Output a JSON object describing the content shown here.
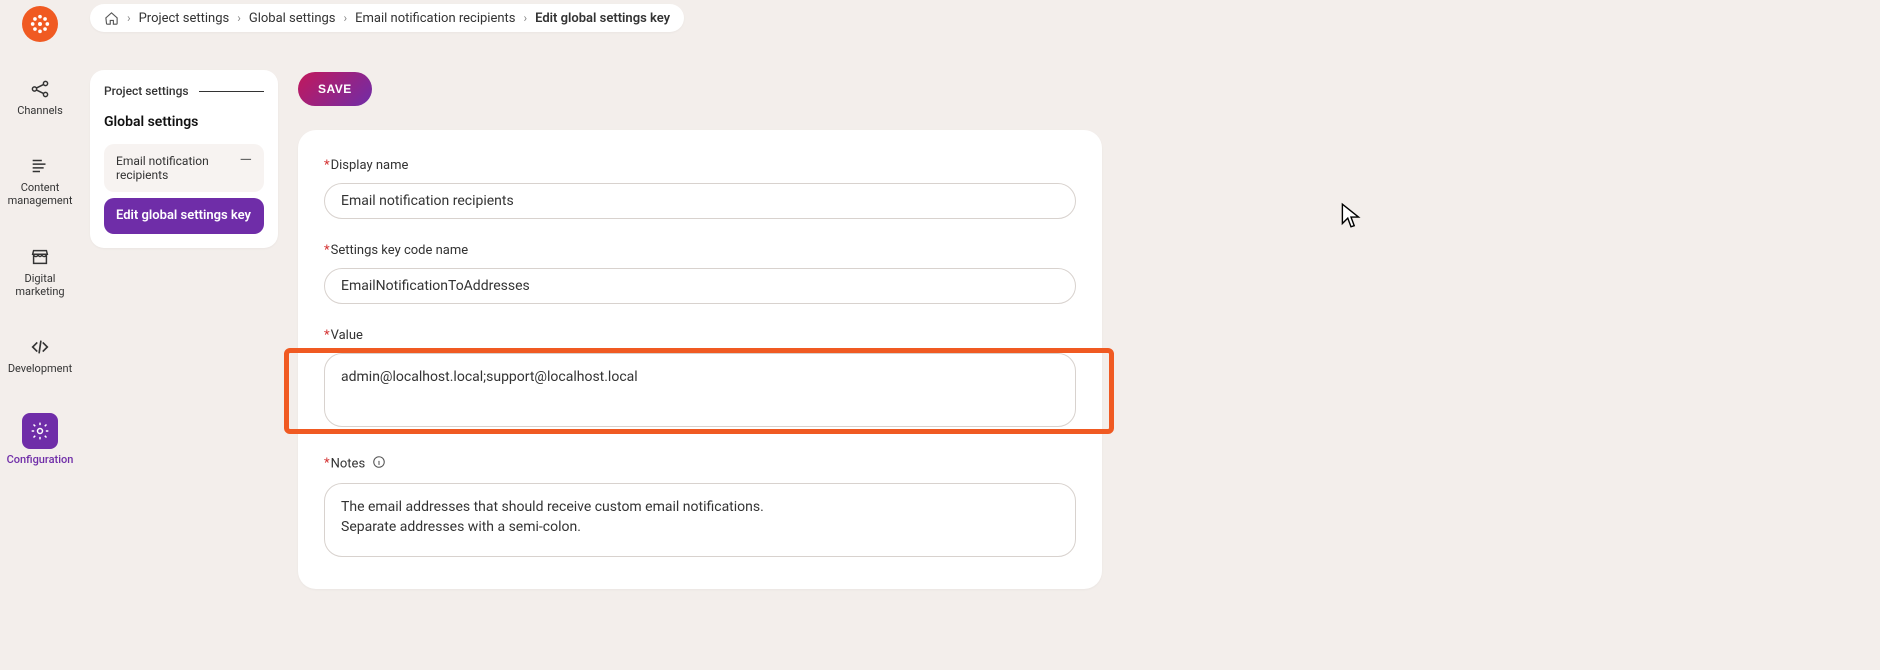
{
  "logo": {
    "icon": "snowflake-icon"
  },
  "vnav": [
    {
      "id": "channels",
      "label": "Channels",
      "icon": "share-icon",
      "active": false
    },
    {
      "id": "content-management",
      "label": "Content\nmanagement",
      "icon": "lines-icon",
      "active": false
    },
    {
      "id": "digital-marketing",
      "label": "Digital\nmarketing",
      "icon": "store-icon",
      "active": false
    },
    {
      "id": "development",
      "label": "Development",
      "icon": "code-icon",
      "active": false
    },
    {
      "id": "configuration",
      "label": "Configuration",
      "icon": "gear-icon",
      "active": true
    }
  ],
  "breadcrumb": {
    "items": [
      {
        "kind": "home"
      },
      {
        "label": "Project settings"
      },
      {
        "label": "Global settings"
      },
      {
        "label": "Email notification recipients"
      },
      {
        "label": "Edit global settings key",
        "last": true
      }
    ]
  },
  "sidebar": {
    "top_label": "Project settings",
    "heading": "Global settings",
    "sub_item": "Email notification recipients",
    "active_item": "Edit global settings key"
  },
  "save_label": "SAVE",
  "form": {
    "display_name": {
      "label": "Display name",
      "value": "Email notification recipients"
    },
    "code_name": {
      "label": "Settings key code name",
      "value": "EmailNotificationToAddresses"
    },
    "value_field": {
      "label": "Value",
      "value": "admin@localhost.local;support@localhost.local"
    },
    "notes": {
      "label": "Notes",
      "value": "The email addresses that should receive custom email notifications.\nSeparate addresses with a semi-colon."
    }
  }
}
